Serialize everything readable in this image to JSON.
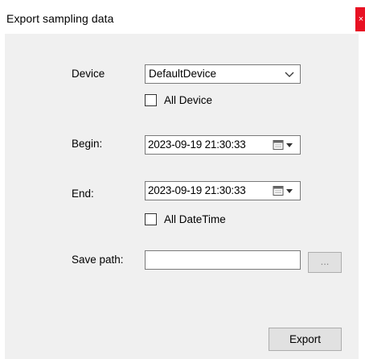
{
  "window": {
    "title": "Export sampling data",
    "close_glyph": "×"
  },
  "form": {
    "device_label": "Device",
    "device_value": "DefaultDevice",
    "all_device_label": "All Device",
    "all_device_checked": false,
    "begin_label": "Begin:",
    "begin_value": "2023-09-19 21:30:33",
    "end_label": "End:",
    "end_value": "2023-09-19 21:30:33",
    "all_datetime_label": "All DateTime",
    "all_datetime_checked": false,
    "save_path_label": "Save path:",
    "save_path_value": "",
    "browse_label": "...",
    "export_label": "Export"
  }
}
